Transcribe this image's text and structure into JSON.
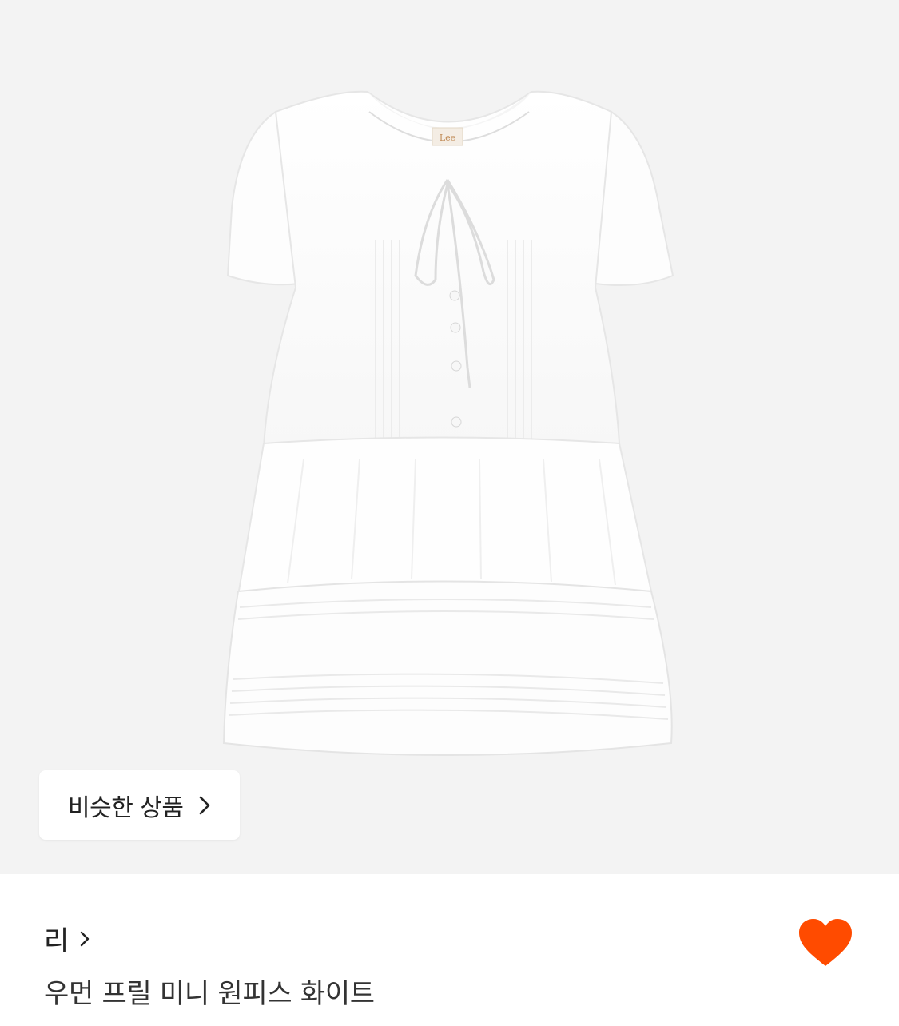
{
  "product_image": {
    "background_color": "#f3f3f3",
    "garment_label_text": "Lee",
    "similar_products_button": {
      "label": "비슷한 상품",
      "icon": "chevron-right-icon"
    }
  },
  "product_info": {
    "brand": {
      "name": "리",
      "icon": "chevron-right-icon"
    },
    "name": "우먼 프릴 미니 원피스 화이트",
    "like": {
      "icon": "heart-icon",
      "state": "liked",
      "color": "#ff4b00"
    }
  }
}
